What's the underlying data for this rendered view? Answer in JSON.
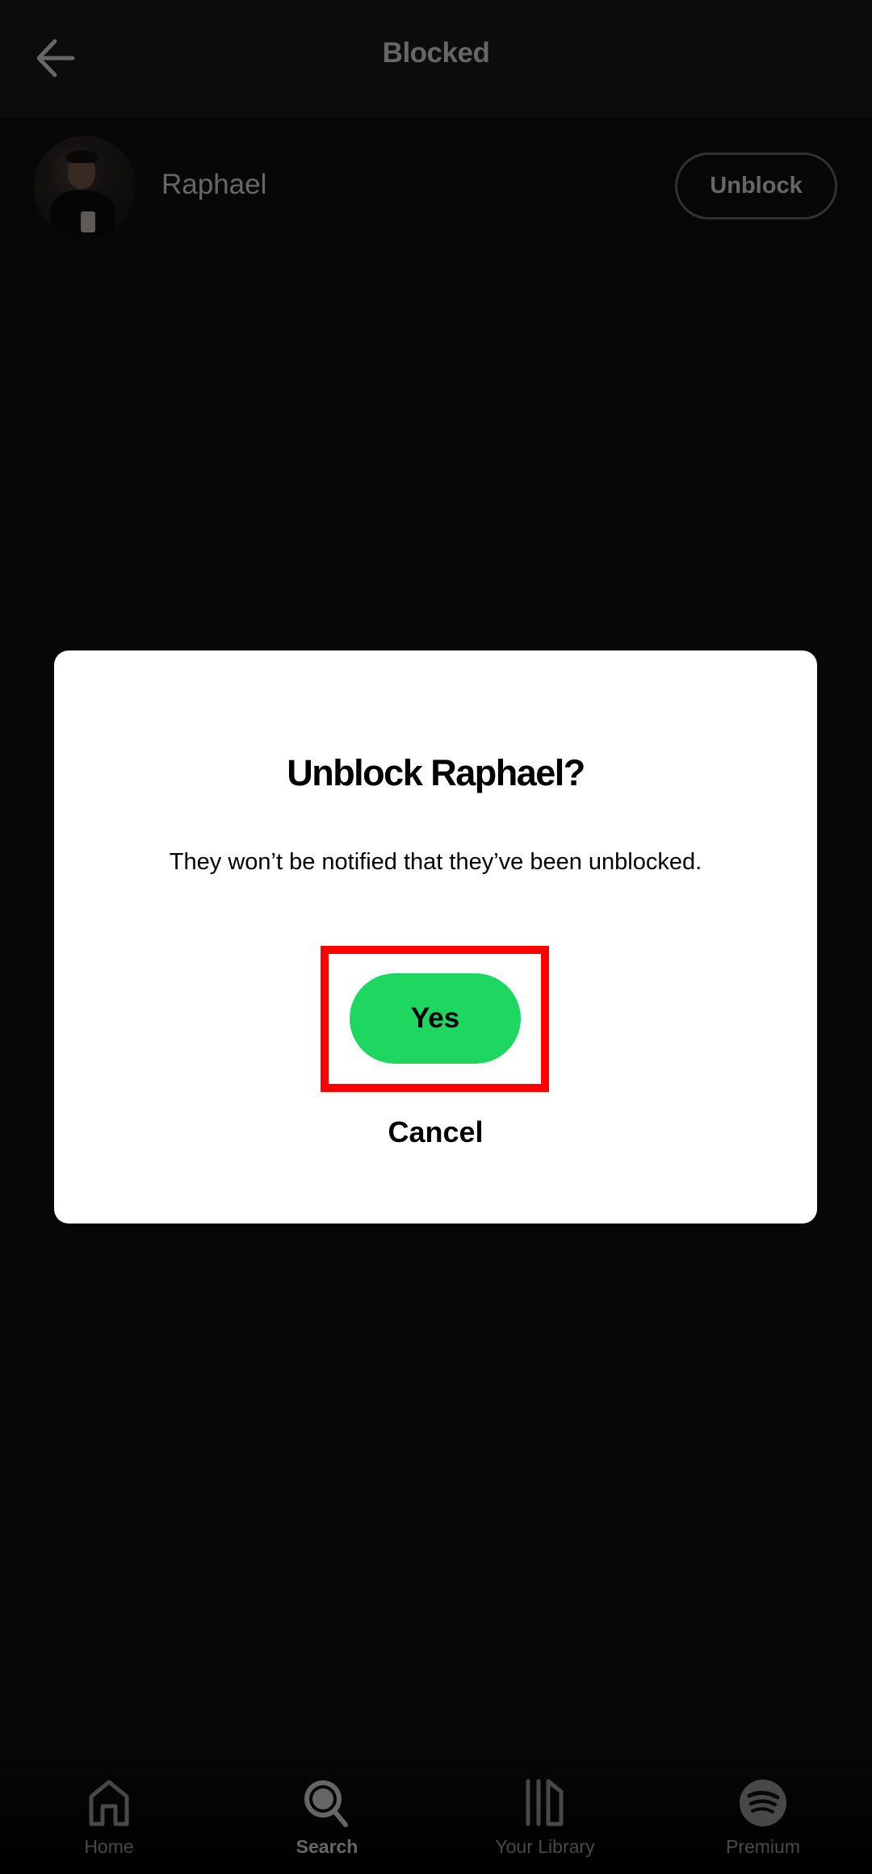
{
  "header": {
    "title": "Blocked",
    "back_icon": "arrow-left-icon"
  },
  "blocked_list": [
    {
      "name": "Raphael",
      "avatar": "profile-photo",
      "action_label": "Unblock"
    }
  ],
  "dialog": {
    "title": "Unblock Raphael?",
    "message": "They won’t be notified that they’ve been unblocked.",
    "confirm_label": "Yes",
    "cancel_label": "Cancel",
    "confirm_color": "#1ed760",
    "highlight_color": "#ff0000"
  },
  "bottom_nav": {
    "active": "Search",
    "items": [
      {
        "label": "Home",
        "icon": "home-icon"
      },
      {
        "label": "Search",
        "icon": "search-icon"
      },
      {
        "label": "Your Library",
        "icon": "library-icon"
      },
      {
        "label": "Premium",
        "icon": "spotify-logo-icon"
      }
    ]
  }
}
